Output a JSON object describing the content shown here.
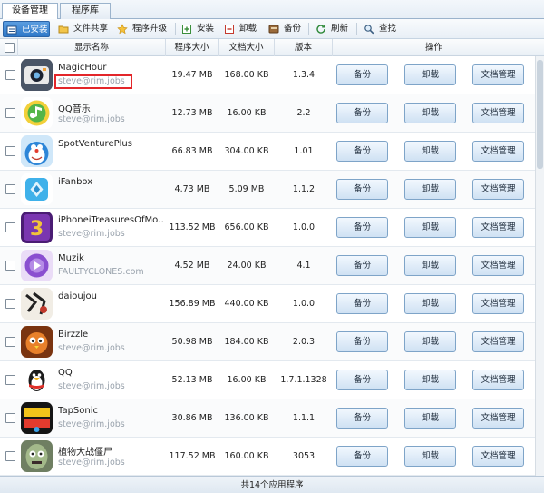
{
  "tabs": [
    {
      "label": "设备管理"
    },
    {
      "label": "程序库"
    }
  ],
  "toolbar": {
    "installed": "已安装",
    "file_share": "文件共享",
    "upgrade": "程序升级",
    "install": "安装",
    "uninstall": "卸载",
    "backup": "备份",
    "refresh": "刷新",
    "search": "查找"
  },
  "columns": {
    "name": "显示名称",
    "size": "程序大小",
    "doc_size": "文档大小",
    "version": "版本",
    "actions": "操作"
  },
  "buttons": {
    "backup": "备份",
    "uninstall": "卸载",
    "docs": "文档管理"
  },
  "apps": [
    {
      "name": "MagicHour",
      "developer": "steve@rim.jobs",
      "size": "19.47 MB",
      "doc_size": "168.00 KB",
      "version": "1.3.4",
      "icon": "magichour-icon",
      "color": "#3a3f4a"
    },
    {
      "name": "QQ音乐",
      "developer": "steve@rim.jobs",
      "size": "12.73 MB",
      "doc_size": "16.00 KB",
      "version": "2.2",
      "icon": "qqmusic-icon",
      "color": "#f2d03a"
    },
    {
      "name": "SpotVenturePlus",
      "developer": "steve@rim.jobs",
      "size": "66.83 MB",
      "doc_size": "304.00 KB",
      "version": "1.01",
      "icon": "doraemon-icon",
      "color": "#3e8fdc"
    },
    {
      "name": "iFanbox",
      "developer": "steve@rim.jobs",
      "size": "4.73 MB",
      "doc_size": "5.09 MB",
      "version": "1.1.2",
      "icon": "ifanbox-icon",
      "color": "#38a9e8"
    },
    {
      "name": "iPhoneiTreasuresOfMo…",
      "developer": "steve@rim.jobs",
      "size": "113.52 MB",
      "doc_size": "656.00 KB",
      "version": "1.0.0",
      "icon": "treasures-icon",
      "color": "#6b2f9a"
    },
    {
      "name": "Muzik",
      "developer": "FAULTYCLONES.com",
      "size": "4.52 MB",
      "doc_size": "24.00 KB",
      "version": "4.1",
      "icon": "muzik-icon",
      "color": "#8a4fd0"
    },
    {
      "name": "daioujou",
      "developer": "steve@rim.jobs",
      "size": "156.89 MB",
      "doc_size": "440.00 KB",
      "version": "1.0.0",
      "icon": "daioujou-icon",
      "color": "#e9e6e0"
    },
    {
      "name": "Birzzle",
      "developer": "steve@rim.jobs",
      "size": "50.98 MB",
      "doc_size": "184.00 KB",
      "version": "2.0.3",
      "icon": "birzzle-icon",
      "color": "#d8742a"
    },
    {
      "name": "QQ",
      "developer": "steve@rim.jobs",
      "size": "52.13 MB",
      "doc_size": "16.00 KB",
      "version": "1.7.1.1328",
      "icon": "qq-penguin-icon",
      "color": "#ffffff"
    },
    {
      "name": "TapSonic",
      "developer": "steve@rim.jobs",
      "size": "30.86 MB",
      "doc_size": "136.00 KB",
      "version": "1.1.1",
      "icon": "tapsonic-icon",
      "color": "#1b1b1b"
    },
    {
      "name": "植物大战僵尸",
      "developer": "steve@rim.jobs",
      "size": "117.52 MB",
      "doc_size": "160.00 KB",
      "version": "3053",
      "icon": "zombie-icon",
      "color": "#7a9a6a"
    }
  ],
  "status": "共14个应用程序",
  "colors": {
    "accent": "#2e78c8",
    "highlight": "#e3262a"
  }
}
